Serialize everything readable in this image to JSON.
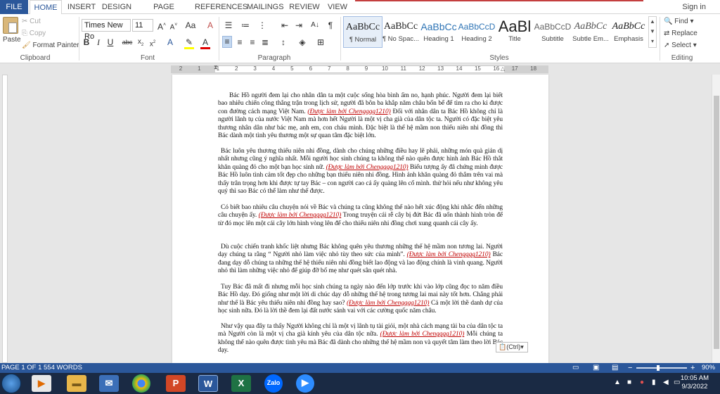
{
  "tabs": [
    {
      "label": "FILE"
    },
    {
      "label": "HOME"
    },
    {
      "label": "INSERT"
    },
    {
      "label": "DESIGN"
    },
    {
      "label": "PAGE LAYOUT"
    },
    {
      "label": "REFERENCES"
    },
    {
      "label": "MAILINGS"
    },
    {
      "label": "REVIEW"
    },
    {
      "label": "VIEW"
    }
  ],
  "sign_in": "Sign in",
  "clipboard": {
    "paste": "Paste",
    "cut": "Cut",
    "copy": "Copy",
    "format_painter": "Format Painter",
    "label": "Clipboard"
  },
  "font": {
    "name": "Times New Ro",
    "size": "11",
    "label": "Font"
  },
  "paragraph": {
    "label": "Paragraph"
  },
  "styles": {
    "label": "Styles",
    "items": [
      {
        "preview": "AaBbCc",
        "name": "¶ Normal"
      },
      {
        "preview": "AaBbCc",
        "name": "¶ No Spac..."
      },
      {
        "preview": "AaBbCc",
        "name": "Heading 1"
      },
      {
        "preview": "AaBbCcD",
        "name": "Heading 2"
      },
      {
        "preview": "AaBl",
        "name": "Title"
      },
      {
        "preview": "AaBbCcD",
        "name": "Subtitle"
      },
      {
        "preview": "AaBbCc",
        "name": "Subtle Em..."
      },
      {
        "preview": "AaBbCc",
        "name": "Emphasis"
      }
    ]
  },
  "editing": {
    "find": "Find",
    "replace": "Replace",
    "select": "Select",
    "label": "Editing"
  },
  "ruler_numbers": [
    "2",
    "1",
    "1",
    "2",
    "3",
    "4",
    "5",
    "6",
    "7",
    "8",
    "9",
    "10",
    "11",
    "12",
    "13",
    "14",
    "15",
    "16",
    "17",
    "18"
  ],
  "document": {
    "p1_a": "Bác Hồ người đem lại cho nhân dân ta một cuộc sống hòa bình ấm no, hạnh phúc. Người đem lại biết bao nhiêu chiến công thắng trận trong lịch sử, người đã bôn ba khắp năm châu bốn bể để tìm ra cho ki được con đường cách mạng Việt Nam.",
    "p1_cite": "(Được làm bởi Chengggg1210)",
    "p1_b": "Đối với nhân dân ta Bác Hồ không chỉ là người lãnh tụ của nước Việt Nam mà hơn hết Người là một vị cha già của dân tộc ta. Người có đặc biệt yêu thương nhân dân như bác mẹ, anh em, con cháu mình. Đặc biệt là thế hệ mầm non thiếu niên nhi đồng thì Bác dành một tình yêu thương một sự quan tâm đặc biệt lớn.",
    "p2_a": "Bác luôn yêu thương thiếu niên nhi đồng, dành cho chúng những điều hay lẽ phải, những món quà giản dị nhất nhưng cũng ý nghĩa nhất. Mỗi người học sinh chúng ta không thể nào quên được hình ảnh Bác Hồ thắt khăn quàng đỏ cho một bạn học sinh nữ.",
    "p2_cite": "(Được làm bởi Chengggg1210)",
    "p2_b": "Biểu tượng ấy đã chứng minh được Bác Hồ luôn tình cảm tốt đẹp cho những bạn thiếu niên nhi đồng. Hình ảnh khăn quàng đỏ thắm trên vai mà thấy trân trọng hơn khi được tự tay Bác – con người cao cả ấy quàng lên cổ mình. thử hỏi nếu như không yêu quý thì sao Bác có thể làm như thế được.",
    "p3_a": "Có biết bao nhiêu câu chuyện nói về Bác và chúng ta cũng không thể nào hết xúc động khi nhắc đến những câu chuyện ấy.",
    "p3_cite": "(Được làm bởi Chengggg1210)",
    "p3_b": "Trong truyện cái rễ cây bị đứt Bác đã uốn thành hình tròn để từ đó mọc lên một cái cây lớn hình vòng lên để cho thiếu niên nhi đồng chơi xung quanh cái cây ấy.",
    "p4_a": "Dù cuộc chiến tranh khốc liệt nhưng Bác không quên yêu thương những thế hệ mầm non tương lai. Người dạy chúng ta rằng “ Người nhỏ làm việc nhỏ tùy theo sức của mình”.",
    "p4_cite": "(Được làm bởi Chengggg1210)",
    "p4_b": "Bác đang dạy dỗ chúng ta những thế hệ thiếu niên nhi đồng biết lao động và lao động chính là vinh quang. Người nhỏ thì làm những việc nhỏ để giúp đỡ bố mẹ như quét sân quét nhà.",
    "p5_a": "Tuy Bác đã mất đi nhưng mỗi học sinh chúng ta ngày nào đến lớp trước khi vào lớp cũng đọc to năm điều Bác Hồ dạy. Đó giống như một lời di chúc dạy dỗ những thế hệ trong tương lai mai này tốt hơn. Chẳng phải như thế là Bác yêu thiếu niên nhi đồng hay sao?",
    "p5_cite": "(Được làm bởi Chengggg1210)",
    "p5_b": "Cả một lời thề danh dự của học sinh nữa. Đó là lời thề đem lại đất nước sánh vai với các cường quốc năm châu.",
    "p6_a": "Như vậy qua đây ta thấy Người không chỉ là một vị lãnh tụ tài giỏi, một nhà cách mạng tài ba của dân tộc ta mà Người còn là một vị cha già kính yêu của dân tộc nữa.",
    "p6_cite": "(Được làm bởi Chengggg1210)",
    "p6_b": "Mỗi chúng ta không thể nào quên được tình yêu mà Bác đã dành cho những thế hệ mầm non và quyết tâm làm theo lời Bác dạy."
  },
  "paste_options": "(Ctrl)",
  "status": {
    "page": "PAGE 1 OF 1",
    "words": "554 WORDS",
    "zoom": "90%"
  },
  "clock": {
    "time": "10:05 AM",
    "date": "9/3/2022"
  },
  "taskbar_apps": [
    "chrome-icon",
    "powerpoint-icon",
    "word-icon",
    "excel-icon",
    "zalo-icon",
    "zoom-icon"
  ],
  "colors": {
    "accent": "#2b579a",
    "cite": "#c00000",
    "taskbar": "#1a2a44"
  }
}
